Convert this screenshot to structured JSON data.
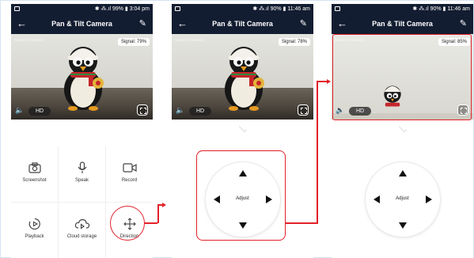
{
  "screens": [
    {
      "status": {
        "right": "✱ ⁂.ıl 99% ▮ 3:04 pm"
      },
      "title": "Pan & Tilt Camera",
      "video": {
        "timestamp": "2020-07-15 15:04:22",
        "signal": "Signal: 79%",
        "hd": "HD"
      },
      "controls": [
        {
          "label": "Screenshot",
          "icon": "camera-icon"
        },
        {
          "label": "Speak",
          "icon": "microphone-icon"
        },
        {
          "label": "Record",
          "icon": "video-record-icon"
        },
        {
          "label": "Playback",
          "icon": "playback-icon"
        },
        {
          "label": "Cloud storage",
          "icon": "cloud-storage-icon"
        },
        {
          "label": "Direction",
          "icon": "direction-move-icon"
        }
      ]
    },
    {
      "status": {
        "right": "✱ ⁂.ıl 90% ▮ 11:46 am"
      },
      "title": "Pan & Tilt Camera",
      "video": {
        "timestamp": "2020-07-15 11:46:03",
        "signal": "Signal: 78%",
        "hd": "HD"
      },
      "ptz": {
        "label": "Adjust"
      }
    },
    {
      "status": {
        "right": "✱ ⁂.ıl 90% ▮ 11:46 am"
      },
      "title": "Pan & Tilt Camera",
      "video": {
        "timestamp": "2020-07-15 11:46:21",
        "signal": "Signal: 85%",
        "hd": "HD"
      },
      "ptz": {
        "label": "Adjust"
      }
    }
  ],
  "colors": {
    "appbar": "#131d31",
    "highlight": "#e2212a"
  }
}
